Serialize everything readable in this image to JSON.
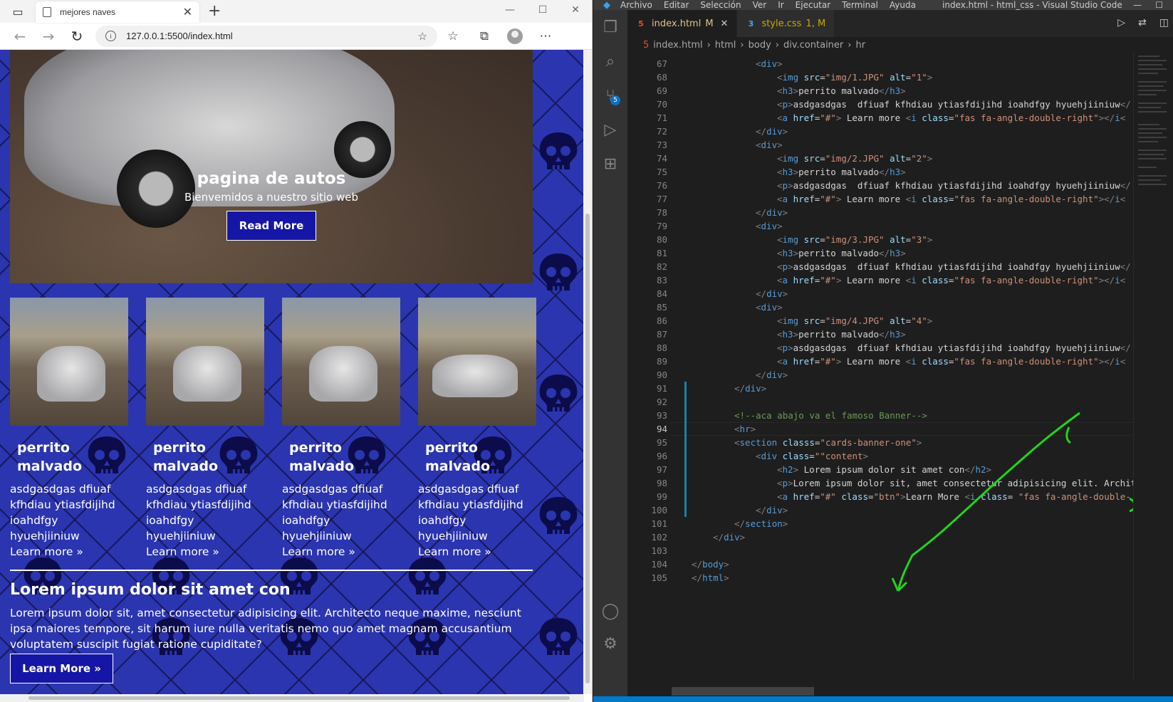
{
  "browser": {
    "tab_title": "mejores naves",
    "url": "127.0.0.1:5500/index.html"
  },
  "page": {
    "hero": {
      "title": "pagina de autos",
      "subtitle": "Bienvemidos a nuestro sitio web",
      "button": "Read More"
    },
    "cards": [
      {
        "title": "perrito malvado",
        "text": "asdgasdgas dfiuaf kfhdiau ytiasfdijihd ioahdfgy hyuehjiiniuw",
        "link": "Learn more »"
      },
      {
        "title": "perrito malvado",
        "text": "asdgasdgas dfiuaf kfhdiau ytiasfdijihd ioahdfgy hyuehjiiniuw",
        "link": "Learn more »"
      },
      {
        "title": "perrito malvado",
        "text": "asdgasdgas dfiuaf kfhdiau ytiasfdijihd ioahdfgy hyuehjiiniuw",
        "link": "Learn more »"
      },
      {
        "title": "perrito malvado",
        "text": "asdgasdgas dfiuaf kfhdiau ytiasfdijihd ioahdfgy hyuehjiiniuw",
        "link": "Learn more »"
      }
    ],
    "banner": {
      "heading": "Lorem ipsum dolor sit amet con",
      "text": "Lorem ipsum dolor sit, amet consectetur adipisicing elit. Architecto neque maxime, nesciunt ipsa maiores tempore, sit harum iure nulla veritatis nemo quo amet magnam accusantium voluptatem suscipit fugiat ratione cupiditate?",
      "button": "Learn More »"
    },
    "colors": {
      "page_bg": "#2b35b0",
      "button_bg": "#1616a6"
    }
  },
  "vscode": {
    "menu": [
      "Archivo",
      "Editar",
      "Selección",
      "Ver",
      "Ir",
      "Ejecutar",
      "Terminal",
      "Ayuda"
    ],
    "window_title": "index.html - html_css - Visual Studio Code",
    "tabs": [
      {
        "label": "index.html",
        "status": "M",
        "icon": "html-icon",
        "active": true
      },
      {
        "label": "style.css",
        "status": "1, M",
        "icon": "css-icon",
        "active": false
      }
    ],
    "breadcrumb": [
      "index.html",
      "html",
      "body",
      "div.container",
      "hr"
    ],
    "scm_badge": "5",
    "current_line": 94,
    "lines": [
      {
        "n": 67,
        "i": 3,
        "s": [
          [
            "br",
            "<"
          ],
          [
            "tag",
            "div"
          ],
          [
            "br",
            ">"
          ]
        ]
      },
      {
        "n": 68,
        "i": 4,
        "s": [
          [
            "br",
            "<"
          ],
          [
            "tag",
            "img "
          ],
          [
            "attr",
            "src"
          ],
          [
            "txt",
            "="
          ],
          [
            "str",
            "\"img/1.JPG\""
          ],
          [
            "txt",
            " "
          ],
          [
            "attr",
            "alt"
          ],
          [
            "txt",
            "="
          ],
          [
            "str",
            "\"1\""
          ],
          [
            "br",
            ">"
          ]
        ]
      },
      {
        "n": 69,
        "i": 4,
        "s": [
          [
            "br",
            "<"
          ],
          [
            "tag",
            "h3"
          ],
          [
            "br",
            ">"
          ],
          [
            "txt",
            "perrito malvado"
          ],
          [
            "br",
            "</"
          ],
          [
            "tag",
            "h3"
          ],
          [
            "br",
            ">"
          ]
        ]
      },
      {
        "n": 70,
        "i": 4,
        "s": [
          [
            "br",
            "<"
          ],
          [
            "tag",
            "p"
          ],
          [
            "br",
            ">"
          ],
          [
            "txt",
            "asdgasdgas  dfiuaf kfhdiau ytiasfdijihd ioahdfgy hyuehjiiniuw"
          ],
          [
            "br",
            "</"
          ]
        ]
      },
      {
        "n": 71,
        "i": 4,
        "s": [
          [
            "br",
            "<"
          ],
          [
            "tag",
            "a "
          ],
          [
            "attr",
            "href"
          ],
          [
            "txt",
            "="
          ],
          [
            "str",
            "\"#\""
          ],
          [
            "br",
            ">"
          ],
          [
            "txt",
            " Learn more "
          ],
          [
            "br",
            "<"
          ],
          [
            "tag",
            "i "
          ],
          [
            "attr",
            "class"
          ],
          [
            "txt",
            "="
          ],
          [
            "str",
            "\"fas fa-angle-double-right\""
          ],
          [
            "br",
            "></"
          ],
          [
            "tag",
            "i"
          ],
          [
            "br",
            "<"
          ]
        ]
      },
      {
        "n": 72,
        "i": 3,
        "s": [
          [
            "br",
            "</"
          ],
          [
            "tag",
            "div"
          ],
          [
            "br",
            ">"
          ]
        ]
      },
      {
        "n": 73,
        "i": 3,
        "s": [
          [
            "br",
            "<"
          ],
          [
            "tag",
            "div"
          ],
          [
            "br",
            ">"
          ]
        ]
      },
      {
        "n": 74,
        "i": 4,
        "s": [
          [
            "br",
            "<"
          ],
          [
            "tag",
            "img "
          ],
          [
            "attr",
            "src"
          ],
          [
            "txt",
            "="
          ],
          [
            "str",
            "\"img/2.JPG\""
          ],
          [
            "txt",
            " "
          ],
          [
            "attr",
            "alt"
          ],
          [
            "txt",
            "="
          ],
          [
            "str",
            "\"2\""
          ],
          [
            "br",
            ">"
          ]
        ]
      },
      {
        "n": 75,
        "i": 4,
        "s": [
          [
            "br",
            "<"
          ],
          [
            "tag",
            "h3"
          ],
          [
            "br",
            ">"
          ],
          [
            "txt",
            "perrito malvado"
          ],
          [
            "br",
            "</"
          ],
          [
            "tag",
            "h3"
          ],
          [
            "br",
            ">"
          ]
        ]
      },
      {
        "n": 76,
        "i": 4,
        "s": [
          [
            "br",
            "<"
          ],
          [
            "tag",
            "p"
          ],
          [
            "br",
            ">"
          ],
          [
            "txt",
            "asdgasdgas  dfiuaf kfhdiau ytiasfdijihd ioahdfgy hyuehjiiniuw"
          ],
          [
            "br",
            "</"
          ]
        ]
      },
      {
        "n": 77,
        "i": 4,
        "s": [
          [
            "br",
            "<"
          ],
          [
            "tag",
            "a "
          ],
          [
            "attr",
            "href"
          ],
          [
            "txt",
            "="
          ],
          [
            "str",
            "\"#\""
          ],
          [
            "br",
            ">"
          ],
          [
            "txt",
            " Learn more "
          ],
          [
            "br",
            "<"
          ],
          [
            "tag",
            "i "
          ],
          [
            "attr",
            "class"
          ],
          [
            "txt",
            "="
          ],
          [
            "str",
            "\"fas fa-angle-double-right\""
          ],
          [
            "br",
            "></"
          ],
          [
            "tag",
            "i"
          ],
          [
            "br",
            "<"
          ]
        ]
      },
      {
        "n": 78,
        "i": 3,
        "s": [
          [
            "br",
            "</"
          ],
          [
            "tag",
            "div"
          ],
          [
            "br",
            ">"
          ]
        ]
      },
      {
        "n": 79,
        "i": 3,
        "s": [
          [
            "br",
            "<"
          ],
          [
            "tag",
            "div"
          ],
          [
            "br",
            ">"
          ]
        ]
      },
      {
        "n": 80,
        "i": 4,
        "s": [
          [
            "br",
            "<"
          ],
          [
            "tag",
            "img "
          ],
          [
            "attr",
            "src"
          ],
          [
            "txt",
            "="
          ],
          [
            "str",
            "\"img/3.JPG\""
          ],
          [
            "txt",
            " "
          ],
          [
            "attr",
            "alt"
          ],
          [
            "txt",
            "="
          ],
          [
            "str",
            "\"3\""
          ],
          [
            "br",
            ">"
          ]
        ]
      },
      {
        "n": 81,
        "i": 4,
        "s": [
          [
            "br",
            "<"
          ],
          [
            "tag",
            "h3"
          ],
          [
            "br",
            ">"
          ],
          [
            "txt",
            "perrito malvado"
          ],
          [
            "br",
            "</"
          ],
          [
            "tag",
            "h3"
          ],
          [
            "br",
            ">"
          ]
        ]
      },
      {
        "n": 82,
        "i": 4,
        "s": [
          [
            "br",
            "<"
          ],
          [
            "tag",
            "p"
          ],
          [
            "br",
            ">"
          ],
          [
            "txt",
            "asdgasdgas  dfiuaf kfhdiau ytiasfdijihd ioahdfgy hyuehjiiniuw"
          ],
          [
            "br",
            "</"
          ]
        ]
      },
      {
        "n": 83,
        "i": 4,
        "s": [
          [
            "br",
            "<"
          ],
          [
            "tag",
            "a "
          ],
          [
            "attr",
            "href"
          ],
          [
            "txt",
            "="
          ],
          [
            "str",
            "\"#\""
          ],
          [
            "br",
            ">"
          ],
          [
            "txt",
            " Learn more "
          ],
          [
            "br",
            "<"
          ],
          [
            "tag",
            "i "
          ],
          [
            "attr",
            "class"
          ],
          [
            "txt",
            "="
          ],
          [
            "str",
            "\"fas fa-angle-double-right\""
          ],
          [
            "br",
            "></"
          ],
          [
            "tag",
            "i"
          ],
          [
            "br",
            "<"
          ]
        ]
      },
      {
        "n": 84,
        "i": 3,
        "s": [
          [
            "br",
            "</"
          ],
          [
            "tag",
            "div"
          ],
          [
            "br",
            ">"
          ]
        ]
      },
      {
        "n": 85,
        "i": 3,
        "s": [
          [
            "br",
            "<"
          ],
          [
            "tag",
            "div"
          ],
          [
            "br",
            ">"
          ]
        ]
      },
      {
        "n": 86,
        "i": 4,
        "s": [
          [
            "br",
            "<"
          ],
          [
            "tag",
            "img "
          ],
          [
            "attr",
            "src"
          ],
          [
            "txt",
            "="
          ],
          [
            "str",
            "\"img/4.JPG\""
          ],
          [
            "txt",
            " "
          ],
          [
            "attr",
            "alt"
          ],
          [
            "txt",
            "="
          ],
          [
            "str",
            "\"4\""
          ],
          [
            "br",
            ">"
          ]
        ]
      },
      {
        "n": 87,
        "i": 4,
        "s": [
          [
            "br",
            "<"
          ],
          [
            "tag",
            "h3"
          ],
          [
            "br",
            ">"
          ],
          [
            "txt",
            "perrito malvado"
          ],
          [
            "br",
            "</"
          ],
          [
            "tag",
            "h3"
          ],
          [
            "br",
            ">"
          ]
        ]
      },
      {
        "n": 88,
        "i": 4,
        "s": [
          [
            "br",
            "<"
          ],
          [
            "tag",
            "p"
          ],
          [
            "br",
            ">"
          ],
          [
            "txt",
            "asdgasdgas  dfiuaf kfhdiau ytiasfdijihd ioahdfgy hyuehjiiniuw"
          ],
          [
            "br",
            "</"
          ]
        ]
      },
      {
        "n": 89,
        "i": 4,
        "s": [
          [
            "br",
            "<"
          ],
          [
            "tag",
            "a "
          ],
          [
            "attr",
            "href"
          ],
          [
            "txt",
            "="
          ],
          [
            "str",
            "\"#\""
          ],
          [
            "br",
            ">"
          ],
          [
            "txt",
            " Learn more "
          ],
          [
            "br",
            "<"
          ],
          [
            "tag",
            "i "
          ],
          [
            "attr",
            "class"
          ],
          [
            "txt",
            "="
          ],
          [
            "str",
            "\"fas fa-angle-double-right\""
          ],
          [
            "br",
            "></"
          ],
          [
            "tag",
            "i"
          ],
          [
            "br",
            "<"
          ]
        ]
      },
      {
        "n": 90,
        "i": 3,
        "s": [
          [
            "br",
            "</"
          ],
          [
            "tag",
            "div"
          ],
          [
            "br",
            ">"
          ]
        ]
      },
      {
        "n": 91,
        "i": 2,
        "s": [
          [
            "br",
            "</"
          ],
          [
            "tag",
            "div"
          ],
          [
            "br",
            ">"
          ]
        ]
      },
      {
        "n": 92,
        "i": 0,
        "s": []
      },
      {
        "n": 93,
        "i": 2,
        "s": [
          [
            "com",
            "<!--aca abajo va el famoso Banner-->"
          ]
        ]
      },
      {
        "n": 94,
        "i": 2,
        "s": [
          [
            "br",
            "<"
          ],
          [
            "tag",
            "hr"
          ],
          [
            "br",
            ">"
          ]
        ]
      },
      {
        "n": 95,
        "i": 2,
        "s": [
          [
            "br",
            "<"
          ],
          [
            "tag",
            "section "
          ],
          [
            "attr",
            "classs"
          ],
          [
            "txt",
            "="
          ],
          [
            "str",
            "\"cards-banner-one\""
          ],
          [
            "br",
            ">"
          ]
        ]
      },
      {
        "n": 96,
        "i": 3,
        "s": [
          [
            "br",
            "<"
          ],
          [
            "tag",
            "div "
          ],
          [
            "attr",
            "class"
          ],
          [
            "txt",
            "="
          ],
          [
            "str",
            "\"\"content"
          ],
          [
            "br",
            ">"
          ]
        ]
      },
      {
        "n": 97,
        "i": 4,
        "s": [
          [
            "br",
            "<"
          ],
          [
            "tag",
            "h2"
          ],
          [
            "br",
            ">"
          ],
          [
            "txt",
            " Lorem ipsum dolor sit amet con"
          ],
          [
            "br",
            "</"
          ],
          [
            "tag",
            "h2"
          ],
          [
            "br",
            ">"
          ]
        ]
      },
      {
        "n": 98,
        "i": 4,
        "s": [
          [
            "br",
            "<"
          ],
          [
            "tag",
            "p"
          ],
          [
            "br",
            ">"
          ],
          [
            "txt",
            "Lorem ipsum dolor sit, amet consectetur adipisicing elit. Archit"
          ]
        ]
      },
      {
        "n": 99,
        "i": 4,
        "s": [
          [
            "br",
            "<"
          ],
          [
            "tag",
            "a "
          ],
          [
            "attr",
            "href"
          ],
          [
            "txt",
            "="
          ],
          [
            "str",
            "\"#\""
          ],
          [
            "txt",
            " "
          ],
          [
            "attr",
            "class"
          ],
          [
            "txt",
            "="
          ],
          [
            "str",
            "\"btn\""
          ],
          [
            "br",
            ">"
          ],
          [
            "txt",
            "Learn More "
          ],
          [
            "br",
            "<"
          ],
          [
            "tag",
            "i "
          ],
          [
            "attr",
            "class"
          ],
          [
            "txt",
            "= "
          ],
          [
            "str",
            "\"fas fa-angle-double-"
          ]
        ]
      },
      {
        "n": 100,
        "i": 3,
        "s": [
          [
            "br",
            "</"
          ],
          [
            "tag",
            "div"
          ],
          [
            "br",
            ">"
          ]
        ]
      },
      {
        "n": 101,
        "i": 2,
        "s": [
          [
            "br",
            "</"
          ],
          [
            "tag",
            "section"
          ],
          [
            "br",
            ">"
          ]
        ]
      },
      {
        "n": 102,
        "i": 1,
        "s": [
          [
            "br",
            "</"
          ],
          [
            "tag",
            "div"
          ],
          [
            "br",
            ">"
          ]
        ]
      },
      {
        "n": 103,
        "i": 0,
        "s": []
      },
      {
        "n": 104,
        "i": 0,
        "s": [
          [
            "br",
            "</"
          ],
          [
            "tag",
            "body"
          ],
          [
            "br",
            ">"
          ]
        ]
      },
      {
        "n": 105,
        "i": 0,
        "s": [
          [
            "br",
            "</"
          ],
          [
            "tag",
            "html"
          ],
          [
            "br",
            ">"
          ]
        ]
      }
    ]
  }
}
